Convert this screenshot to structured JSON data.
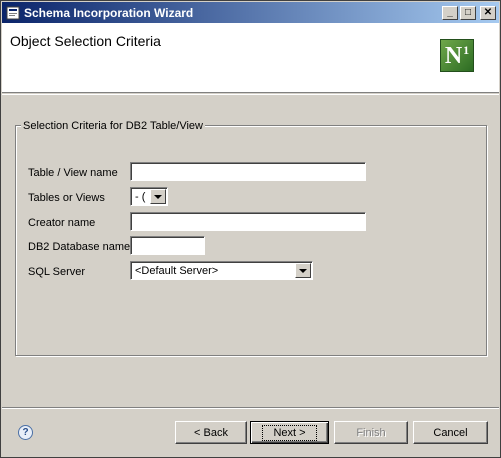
{
  "window": {
    "title": "Schema Incorporation Wizard",
    "controls": {
      "minimize": "_",
      "maximize": "□",
      "close": "✕"
    }
  },
  "header": {
    "page_title": "Object Selection Criteria",
    "logo_text": "N",
    "logo_sup": "1"
  },
  "group": {
    "legend": "Selection Criteria for DB2 Table/View",
    "fields": {
      "table_view_name": {
        "label": "Table / View name",
        "value": ""
      },
      "tables_or_views": {
        "label": "Tables or Views",
        "value": "- ("
      },
      "creator_name": {
        "label": "Creator name",
        "value": ""
      },
      "db2_database_name": {
        "label": "DB2 Database name",
        "value": ""
      },
      "sql_server": {
        "label": "SQL Server",
        "value": "<Default Server>"
      }
    }
  },
  "footer": {
    "help_icon": "?",
    "back_label": "< Back",
    "next_label": "Next >",
    "finish_label": "Finish",
    "cancel_label": "Cancel"
  }
}
